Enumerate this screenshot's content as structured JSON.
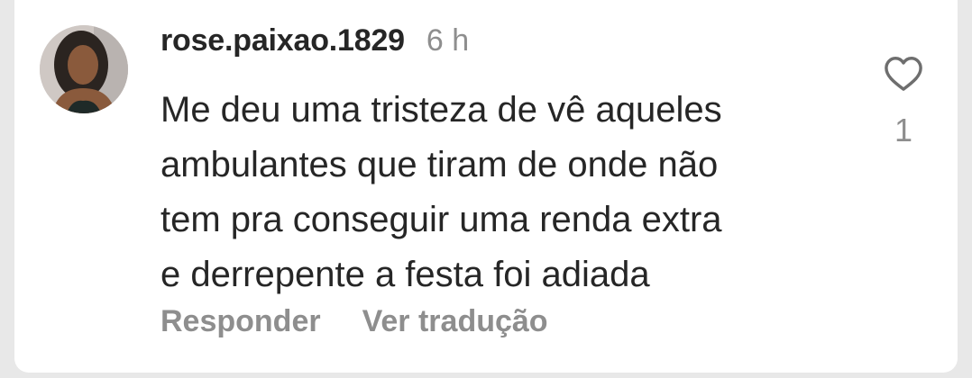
{
  "comment": {
    "username": "rose.paixao.1829",
    "timestamp": "6 h",
    "text": "Me deu uma tristeza de vê aqueles\nambulantes que tiram de onde não\ntem pra conseguir uma renda extra\ne derrepente a festa foi adiada",
    "like_icon": "heart-icon",
    "like_count": "1",
    "actions": {
      "reply_label": "Responder",
      "translate_label": "Ver tradução"
    }
  }
}
